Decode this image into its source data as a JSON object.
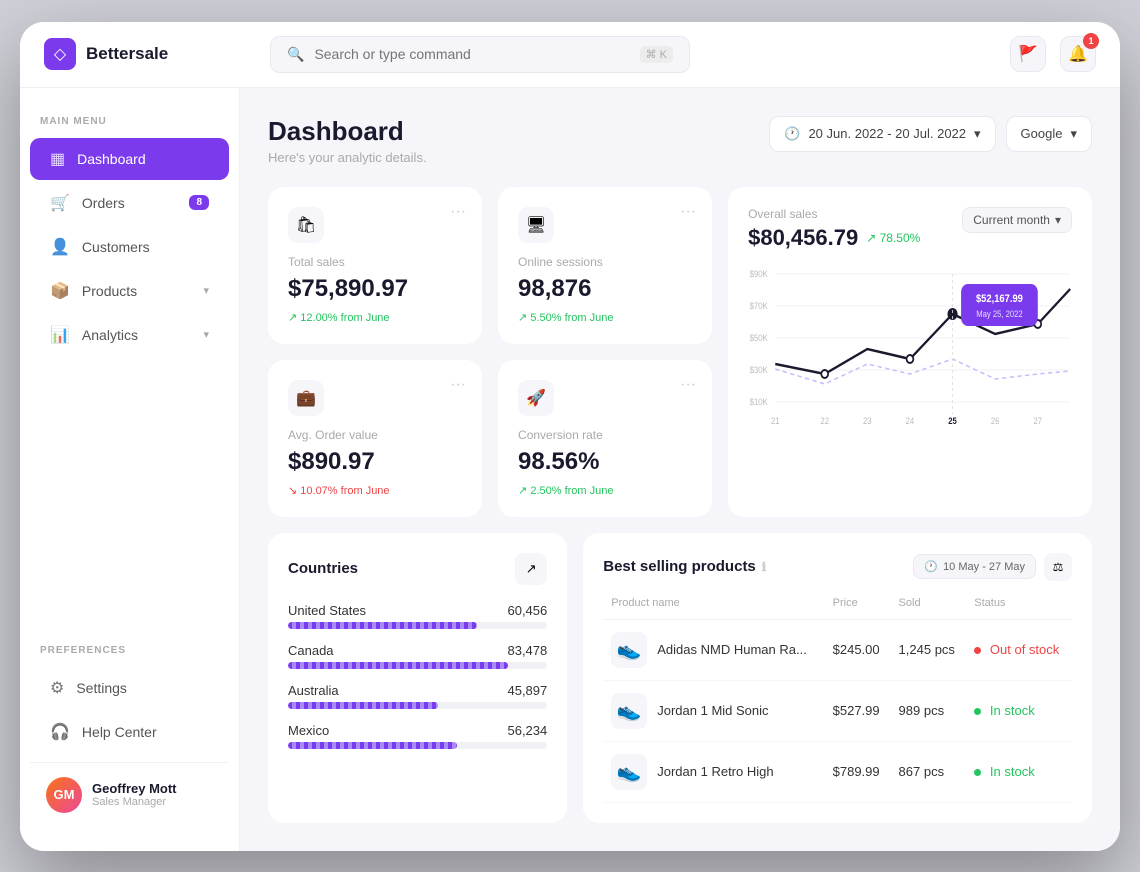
{
  "app": {
    "brand": "Bettersale",
    "search_placeholder": "Search or type command",
    "search_shortcut": "⌘ K"
  },
  "topbar": {
    "notification_count": "1",
    "flag_count": ""
  },
  "sidebar": {
    "main_menu_label": "MAIN MENU",
    "preferences_label": "PREFERENCES",
    "items": [
      {
        "id": "dashboard",
        "label": "Dashboard",
        "icon": "▦",
        "active": true
      },
      {
        "id": "orders",
        "label": "Orders",
        "icon": "🛒",
        "badge": "8"
      },
      {
        "id": "customers",
        "label": "Customers",
        "icon": "👤"
      },
      {
        "id": "products",
        "label": "Products",
        "icon": "📦",
        "chevron": "▾"
      },
      {
        "id": "analytics",
        "label": "Analytics",
        "icon": "📊",
        "chevron": "▾"
      }
    ],
    "pref_items": [
      {
        "id": "settings",
        "label": "Settings",
        "icon": "⚙"
      },
      {
        "id": "help",
        "label": "Help Center",
        "icon": "🎧"
      }
    ],
    "user": {
      "name": "Geoffrey Mott",
      "role": "Sales Manager",
      "initials": "GM"
    }
  },
  "dashboard": {
    "title": "Dashboard",
    "subtitle": "Here's your analytic details.",
    "date_range": "20 Jun. 2022 - 20 Jul. 2022",
    "source": "Google",
    "stats": [
      {
        "id": "total-sales",
        "label": "Total sales",
        "value": "$75,890.97",
        "trend": "↗ 12.00% from June",
        "trend_type": "up",
        "icon": "🛍"
      },
      {
        "id": "online-sessions",
        "label": "Online sessions",
        "value": "98,876",
        "trend": "↗ 5.50% from June",
        "trend_type": "up",
        "icon": "🖥"
      },
      {
        "id": "avg-order",
        "label": "Avg. Order value",
        "value": "$890.97",
        "trend": "↘ 10.07% from June",
        "trend_type": "down",
        "icon": "💼"
      },
      {
        "id": "conversion",
        "label": "Conversion rate",
        "value": "98.56%",
        "trend": "↗ 2.50% from June",
        "trend_type": "up",
        "icon": "🚀"
      }
    ],
    "overall_sales": {
      "label": "Overall sales",
      "value": "$80,456.79",
      "trend": "↗ 78.50%",
      "period": "Current month",
      "tooltip_value": "$52,167.99",
      "tooltip_date": "May 25, 2022",
      "x_labels": [
        "21",
        "22",
        "23",
        "24",
        "25",
        "26",
        "27"
      ],
      "y_labels": [
        "$90K",
        "$70K",
        "$50K",
        "$30K",
        "$10K"
      ]
    },
    "countries": {
      "title": "Countries",
      "items": [
        {
          "name": "United States",
          "value": "60,456",
          "pct": 73
        },
        {
          "name": "Canada",
          "value": "83,478",
          "pct": 85
        },
        {
          "name": "Australia",
          "value": "45,897",
          "pct": 58
        },
        {
          "name": "Mexico",
          "value": "56,234",
          "pct": 65
        }
      ]
    },
    "best_selling": {
      "title": "Best selling products",
      "date_range": "10 May - 27 May",
      "columns": [
        "Product name",
        "Price",
        "Sold",
        "Status"
      ],
      "products": [
        {
          "name": "Adidas NMD Human Ra...",
          "price": "$245.00",
          "sold": "1,245 pcs",
          "status": "Out of stock",
          "status_type": "out",
          "icon": "👟"
        },
        {
          "name": "Jordan 1 Mid Sonic",
          "price": "$527.99",
          "sold": "989 pcs",
          "status": "In stock",
          "status_type": "in",
          "icon": "👟"
        },
        {
          "name": "Jordan 1 Retro High",
          "price": "$789.99",
          "sold": "867 pcs",
          "status": "In stock",
          "status_type": "in",
          "icon": "👟"
        }
      ]
    }
  }
}
